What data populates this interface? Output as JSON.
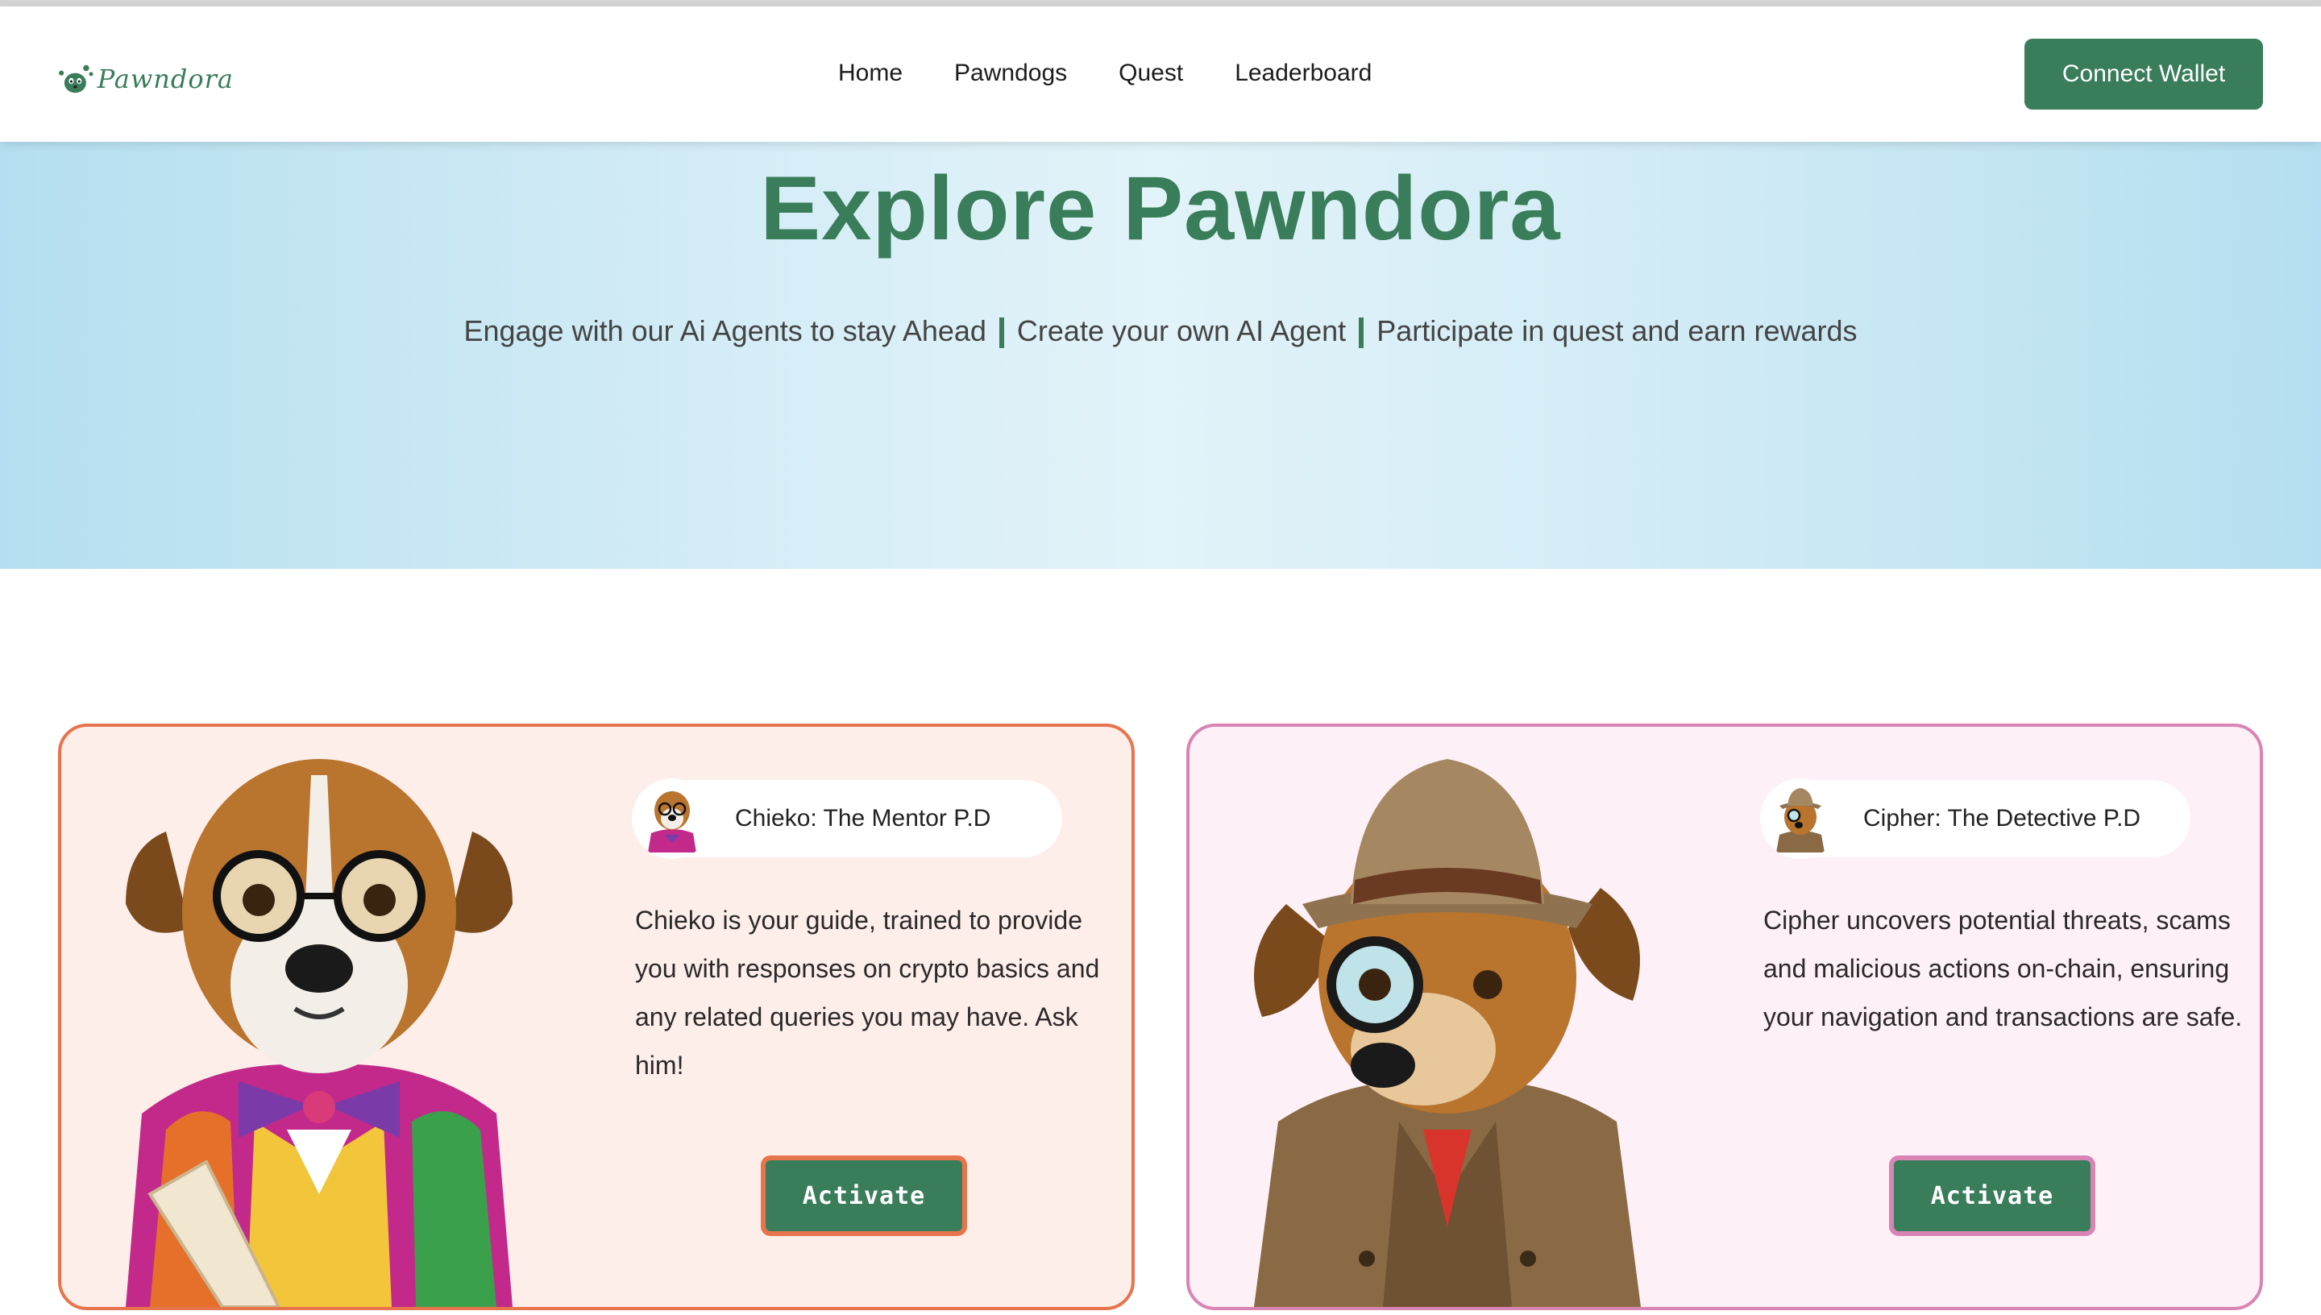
{
  "brand": {
    "logo_text": "Pawndora"
  },
  "nav": {
    "items": [
      {
        "label": "Home"
      },
      {
        "label": "Pawndogs"
      },
      {
        "label": "Quest"
      },
      {
        "label": "Leaderboard"
      }
    ],
    "connect_label": "Connect Wallet"
  },
  "hero": {
    "title": "Explore Pawndora",
    "taglines": [
      "Engage with our Ai Agents to stay Ahead",
      "Create your own AI Agent",
      "Participate in quest and earn rewards"
    ]
  },
  "agents": [
    {
      "name": "Chieko: The Mentor P.D",
      "description": "Chieko is your guide, trained to provide you with responses on crypto basics and any related queries you may have. Ask him!",
      "button_label": "Activate",
      "accent": "#e8744d",
      "background": "#fdeee9"
    },
    {
      "name": "Cipher: The Detective P.D",
      "description": "Cipher uncovers potential threats, scams and malicious actions on-chain, ensuring your navigation and transactions are safe.",
      "button_label": "Activate",
      "accent": "#d884b4",
      "background": "#fdf0f6"
    }
  ],
  "colors": {
    "brand_green": "#3a7d5a",
    "hero_blue": "#b5dff0"
  }
}
